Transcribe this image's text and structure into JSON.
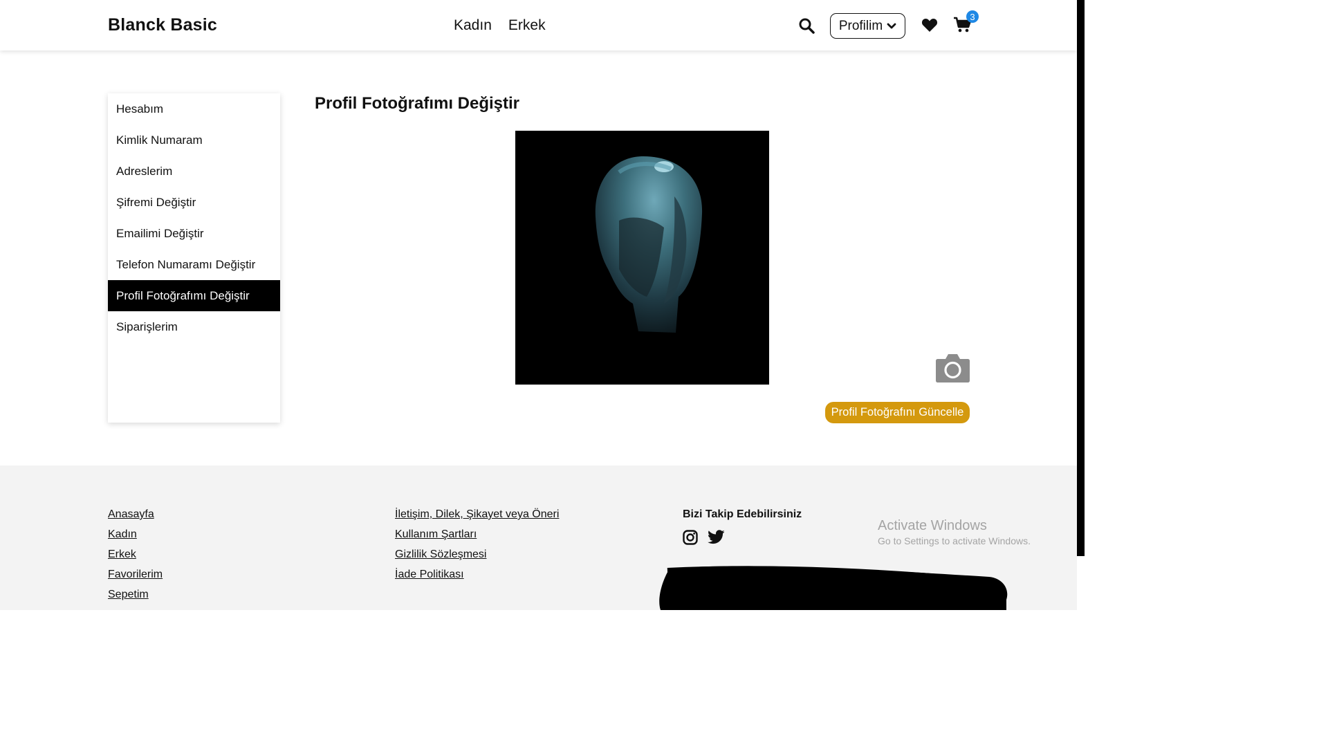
{
  "header": {
    "brand": "Blanck Basic",
    "nav": [
      "Kadın",
      "Erkek"
    ],
    "profile_label": "Profilim",
    "cart_count": "3"
  },
  "sidebar": {
    "items": [
      {
        "label": "Hesabım"
      },
      {
        "label": "Kimlik Numaram"
      },
      {
        "label": "Adreslerim"
      },
      {
        "label": "Şifremi Değiştir"
      },
      {
        "label": "Emailimi Değiştir"
      },
      {
        "label": "Telefon Numaramı Değiştir"
      },
      {
        "label": "Profil Fotoğrafımı Değiştir",
        "active": true
      },
      {
        "label": "Siparişlerim"
      }
    ]
  },
  "main": {
    "title": "Profil Fotoğrafımı Değiştir",
    "update_button": "Profil Fotoğrafını Güncelle"
  },
  "footer": {
    "col1": [
      "Anasayfa",
      "Kadın",
      "Erkek",
      "Favorilerim",
      "Sepetim"
    ],
    "col2": [
      "İletişim, Dilek, Şikayet veya Öneri",
      "Kullanım Şartları",
      "Gizlilik Sözleşmesi",
      "İade Politikası"
    ],
    "follow_title": "Bizi Takip Edebilirsiniz"
  },
  "os_watermark": {
    "line1": "Activate Windows",
    "line2": "Go to Settings to activate Windows."
  },
  "colors": {
    "accent": "#d4990e",
    "badge": "#1e88e5",
    "active_item": "#000000",
    "footer_bg": "#f3f3f3"
  },
  "icons": [
    "search-icon",
    "chevron-down-icon",
    "heart-icon",
    "cart-icon",
    "camera-icon",
    "instagram-icon",
    "twitter-icon"
  ]
}
